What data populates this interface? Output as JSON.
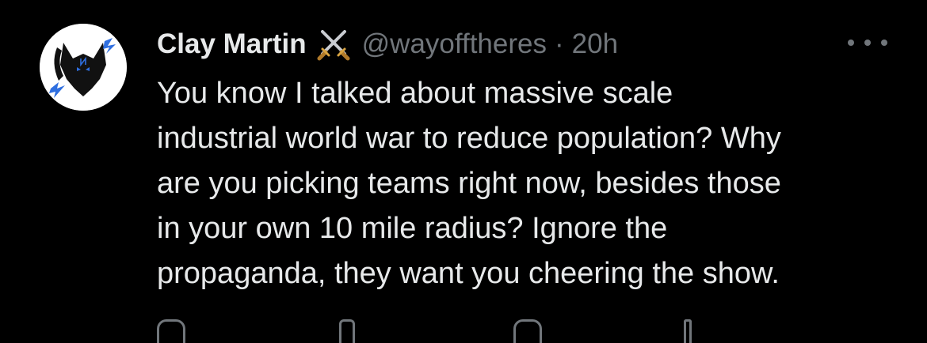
{
  "tweet": {
    "author_name": "Clay Martin",
    "badge_icon": "crossed-swords-icon",
    "handle": "@wayofftheres",
    "separator": "·",
    "timestamp": "20h",
    "more_icon": "more-options-icon",
    "text_lines": [
      "You know I talked about massive scale",
      "industrial world war to reduce population? Why",
      "are you picking teams right now, besides those",
      "in your own 10 mile radius? Ignore the",
      "propaganda, they want you cheering the show."
    ]
  },
  "colors": {
    "background": "#000000",
    "primary_text": "#e7e9ea",
    "secondary_text": "#71767b",
    "avatar_accent": "#2f6fe0"
  }
}
